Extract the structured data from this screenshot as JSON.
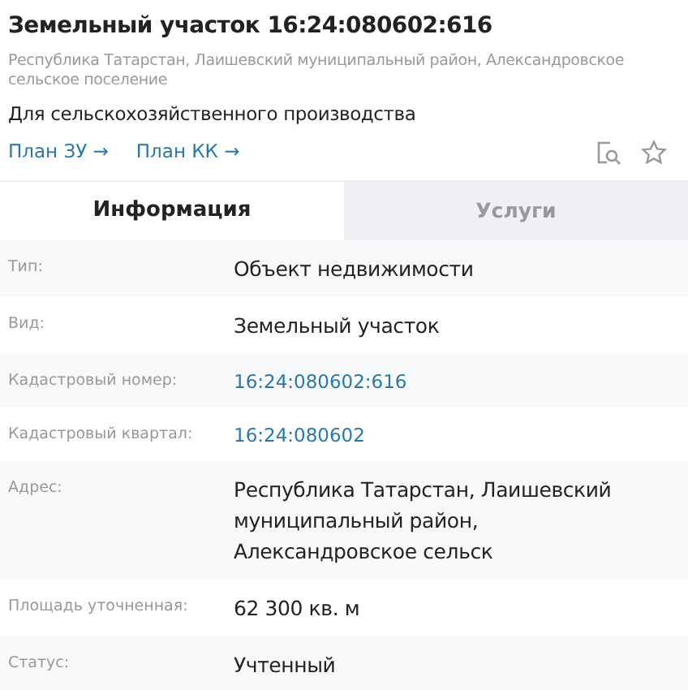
{
  "title": "Земельный участок 16:24:080602:616",
  "location": "Республика Татарстан, Лаишевский муниципальный район, Александровское сельское поселение",
  "purpose": "Для сельскохозяйственного производства",
  "links": [
    {
      "label": "План ЗУ →"
    },
    {
      "label": "План КК →"
    }
  ],
  "tabs": [
    {
      "label": "Информация",
      "selected": true
    },
    {
      "label": "Услуги",
      "selected": false
    }
  ],
  "rows": [
    {
      "label": "Тип:",
      "value": "Объект недвижимости",
      "kind": "text"
    },
    {
      "label": "Вид:",
      "value": "Земельный участок",
      "kind": "text"
    },
    {
      "label": "Кадастровый номер:",
      "value": "16:24:080602:616",
      "kind": "link"
    },
    {
      "label": "Кадастровый квартал:",
      "value": "16:24:080602",
      "kind": "link"
    },
    {
      "label": "Адрес:",
      "value": "Республика Татарстан, Лаишевский муниципальный район, Александровское сельск",
      "kind": "text"
    },
    {
      "label": "Площадь уточненная:",
      "value": "62 300 кв. м",
      "kind": "text"
    },
    {
      "label": "Статус:",
      "value": "Учтенный",
      "kind": "text"
    }
  ]
}
